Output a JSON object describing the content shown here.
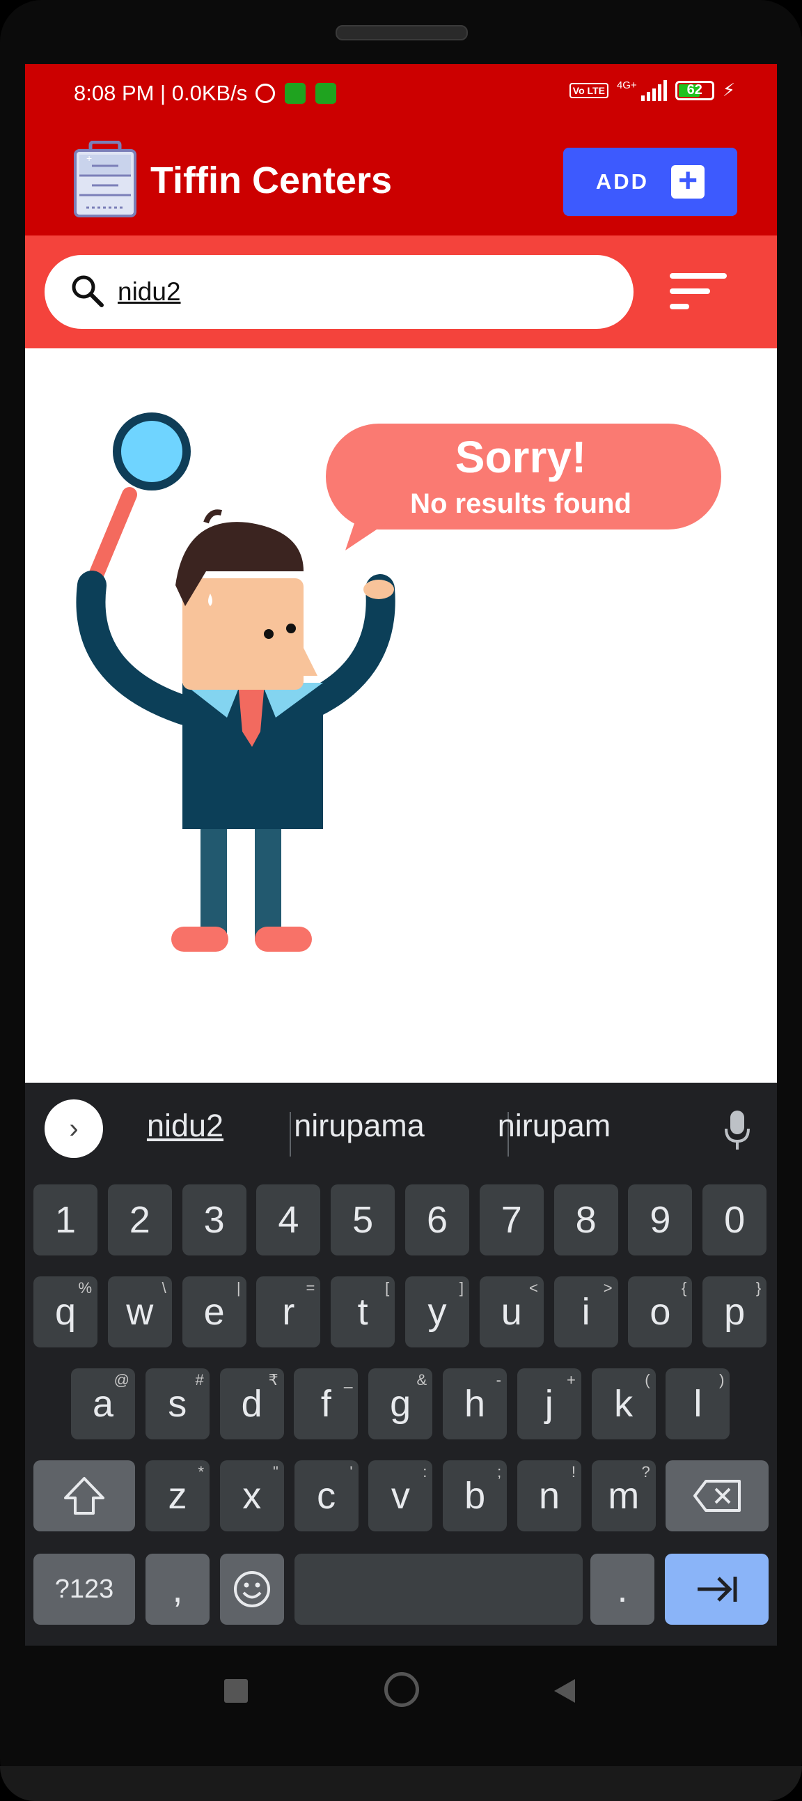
{
  "status_bar": {
    "time_net": "8:08 PM | 0.0KB/s",
    "volte": "Vo LTE",
    "network": "4G+",
    "battery": "62"
  },
  "app_bar": {
    "title": "Tiffin Centers",
    "add_label": "ADD"
  },
  "search": {
    "value": "nidu2"
  },
  "empty_state": {
    "headline": "Sorry!",
    "message": "No results found"
  },
  "keyboard": {
    "suggestions": [
      "nidu2",
      "nirupama",
      "nirupam"
    ],
    "number_row": [
      "1",
      "2",
      "3",
      "4",
      "5",
      "6",
      "7",
      "8",
      "9",
      "0"
    ],
    "row1": [
      {
        "k": "q",
        "s": "%"
      },
      {
        "k": "w",
        "s": "\\"
      },
      {
        "k": "e",
        "s": "|"
      },
      {
        "k": "r",
        "s": "="
      },
      {
        "k": "t",
        "s": "["
      },
      {
        "k": "y",
        "s": "]"
      },
      {
        "k": "u",
        "s": "<"
      },
      {
        "k": "i",
        "s": ">"
      },
      {
        "k": "o",
        "s": "{"
      },
      {
        "k": "p",
        "s": "}"
      }
    ],
    "row2": [
      {
        "k": "a",
        "s": "@"
      },
      {
        "k": "s",
        "s": "#"
      },
      {
        "k": "d",
        "s": "₹"
      },
      {
        "k": "f",
        "s": "_"
      },
      {
        "k": "g",
        "s": "&"
      },
      {
        "k": "h",
        "s": "-"
      },
      {
        "k": "j",
        "s": "+"
      },
      {
        "k": "k",
        "s": "("
      },
      {
        "k": "l",
        "s": ")"
      }
    ],
    "row3": [
      {
        "k": "z",
        "s": "*"
      },
      {
        "k": "x",
        "s": "\""
      },
      {
        "k": "c",
        "s": "'"
      },
      {
        "k": "v",
        "s": ":"
      },
      {
        "k": "b",
        "s": ";"
      },
      {
        "k": "n",
        "s": "!"
      },
      {
        "k": "m",
        "s": "?"
      }
    ],
    "symbols_label": "?123",
    "comma": ",",
    "period": "."
  },
  "colors": {
    "status_red": "#cc0000",
    "search_band": "#f4433c",
    "add_button": "#3d5afe",
    "speech_bubble": "#fa7a72"
  },
  "icons": [
    "search-icon",
    "filter-icon",
    "plus-icon",
    "mic-icon",
    "shift-icon",
    "backspace-icon",
    "emoji-icon",
    "enter-icon",
    "recent-apps-icon",
    "home-icon",
    "back-icon"
  ]
}
